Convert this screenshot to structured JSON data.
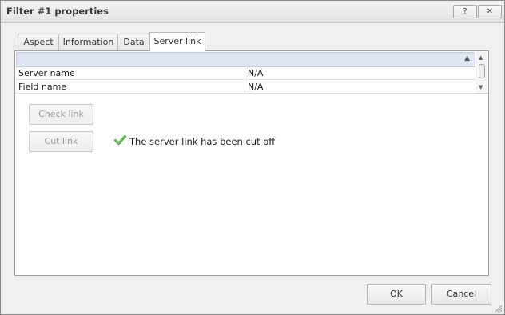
{
  "window": {
    "title": "Filter #1 properties",
    "help_label": "?",
    "close_label": "✕"
  },
  "tabs": [
    {
      "label": "Aspect"
    },
    {
      "label": "Information"
    },
    {
      "label": "Data"
    },
    {
      "label": "Server link",
      "active": true
    }
  ],
  "grid": {
    "rows": [
      {
        "key": "Server name",
        "value": "N/A"
      },
      {
        "key": "Field name",
        "value": "N/A"
      }
    ]
  },
  "actions": {
    "check_link": "Check link",
    "cut_link": "Cut link"
  },
  "status": {
    "message": "The server link has been cut off",
    "icon": "checkmark-icon",
    "color": "#3aa02b"
  },
  "footer": {
    "ok": "OK",
    "cancel": "Cancel"
  }
}
